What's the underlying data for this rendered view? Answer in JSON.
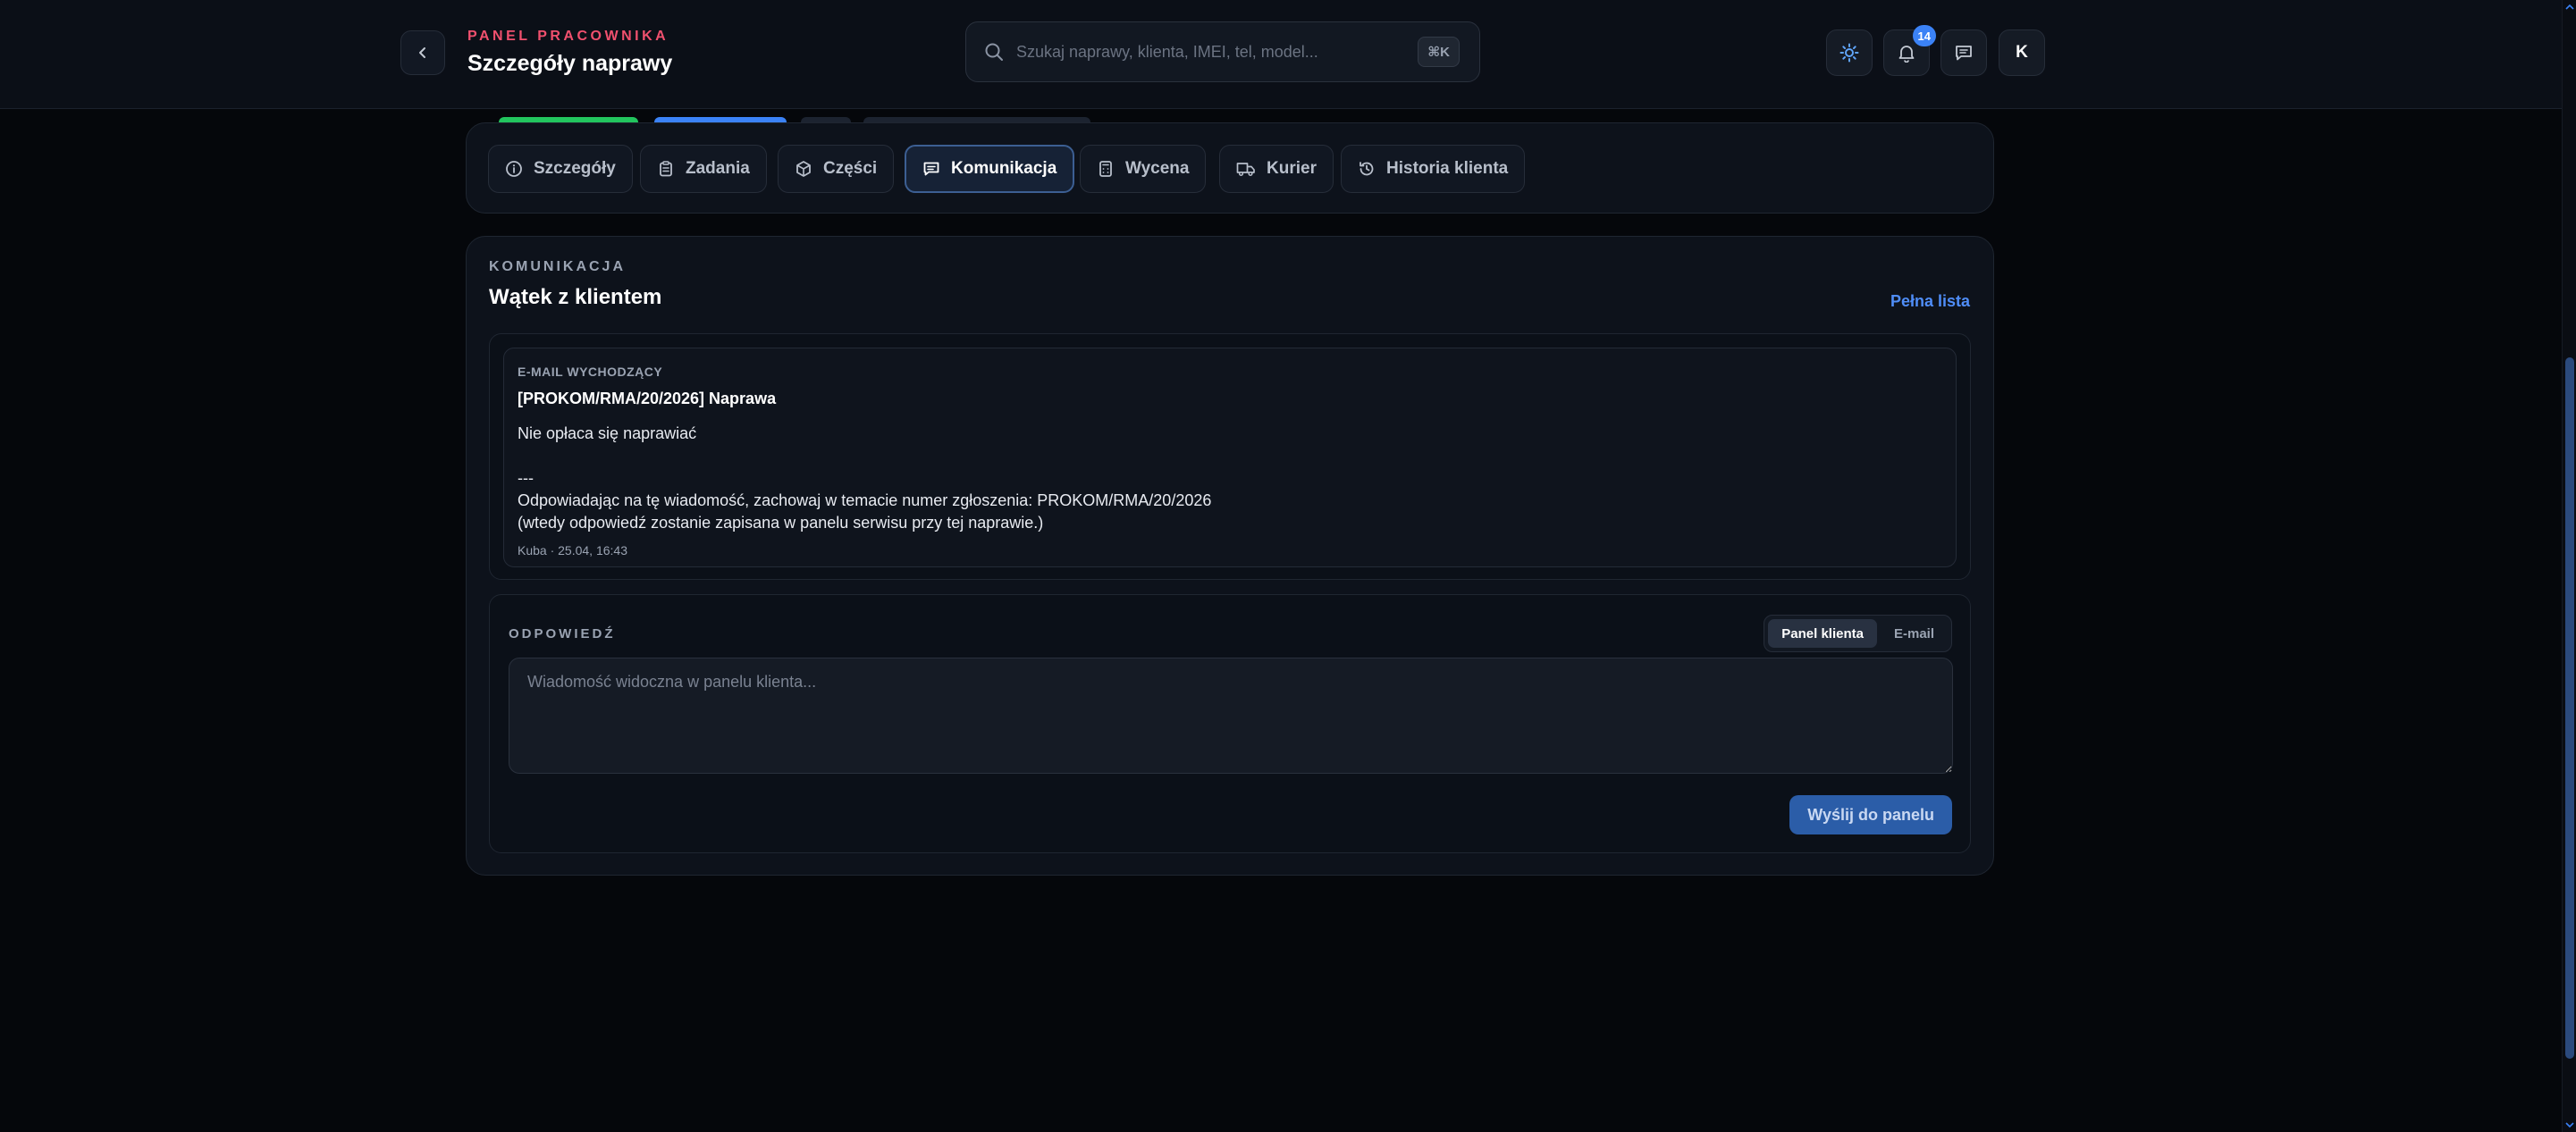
{
  "header": {
    "eyebrow": "PANEL PRACOWNIKA",
    "title": "Szczegóły naprawy",
    "search_placeholder": "Szukaj naprawy, klienta, IMEI, tel, model...",
    "search_shortcut": "⌘K",
    "notifications_count": "14",
    "avatar_initial": "K",
    "icons": [
      "chevron-left-icon",
      "search-icon",
      "sun-icon",
      "bell-icon",
      "chat-icon"
    ]
  },
  "tabs": [
    {
      "label": "Szczegóły",
      "icon": "info-icon",
      "active": false
    },
    {
      "label": "Zadania",
      "icon": "clipboard-icon",
      "active": false
    },
    {
      "label": "Części",
      "icon": "box-icon",
      "active": false
    },
    {
      "label": "Komunikacja",
      "icon": "message-icon",
      "active": true
    },
    {
      "label": "Wycena",
      "icon": "calculator-icon",
      "active": false
    },
    {
      "label": "Kurier",
      "icon": "truck-icon",
      "active": false
    },
    {
      "label": "Historia klienta",
      "icon": "history-icon",
      "active": false
    }
  ],
  "communication": {
    "eyebrow": "KOMUNIKACJA",
    "title": "Wątek z klientem",
    "full_list_label": "Pełna lista",
    "messages": [
      {
        "type": "E-MAIL WYCHODZĄCY",
        "subject": "[PROKOM/RMA/20/2026] Naprawa",
        "body": "Nie opłaca się naprawiać\n\n---\nOdpowiadając na tę wiadomość, zachowaj w temacie numer zgłoszenia: PROKOM/RMA/20/2026\n(wtedy odpowiedź zostanie zapisana w panelu serwisu przy tej naprawie.)",
        "meta": "Kuba · 25.04, 16:43"
      }
    ]
  },
  "reply": {
    "label": "ODPOWIEDŹ",
    "channels": [
      "Panel klienta",
      "E-mail"
    ],
    "active_channel": "Panel klienta",
    "placeholder": "Wiadomość widoczna w panelu klienta...",
    "send_label": "Wyślij do panelu"
  },
  "colors": {
    "accent": "#3b82f6",
    "eyebrow": "#f0506e",
    "link": "#4f8df7",
    "send_button": "#2b5da8"
  }
}
